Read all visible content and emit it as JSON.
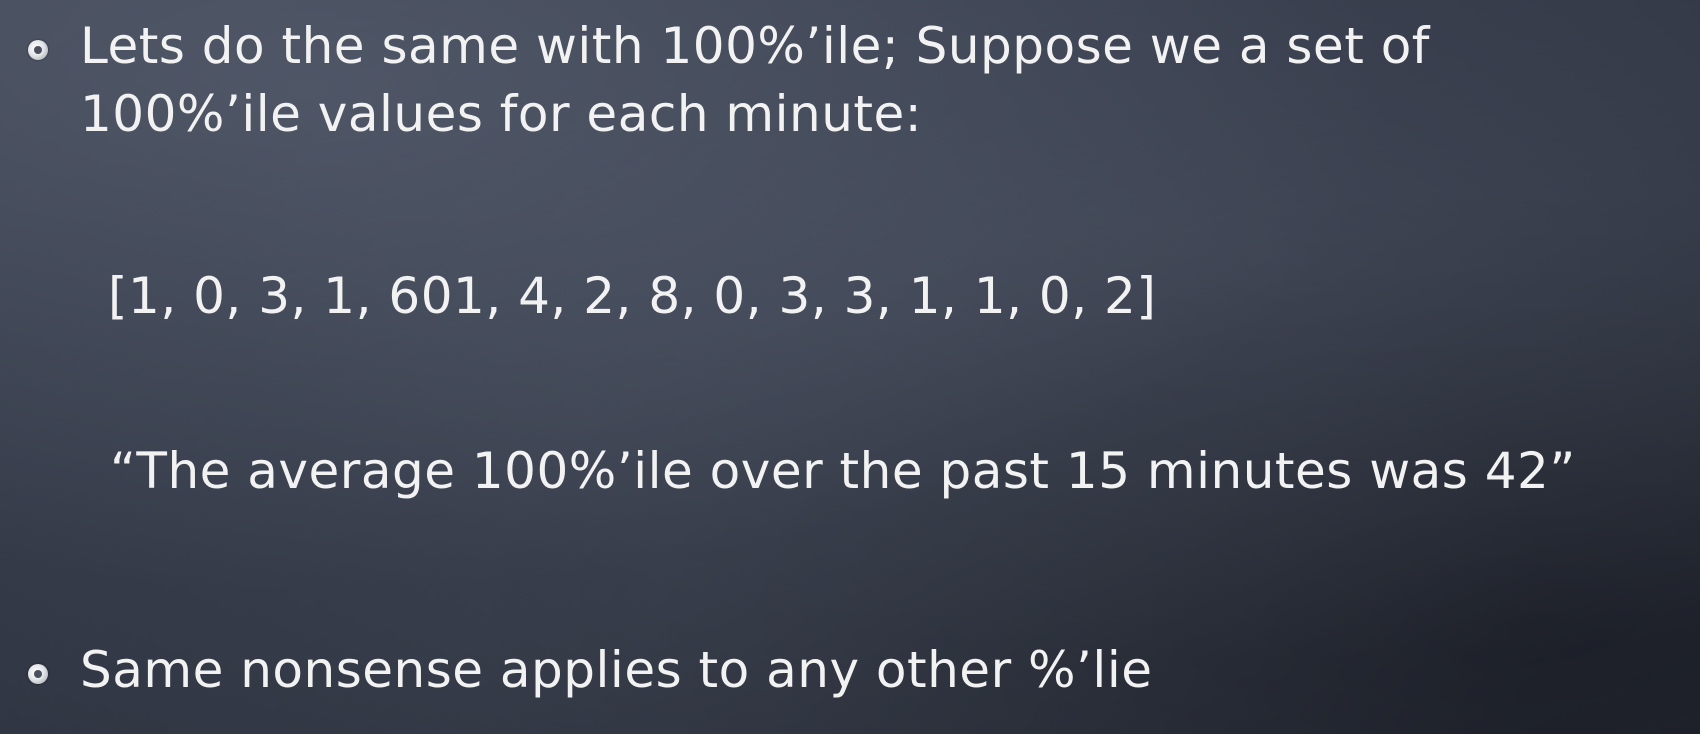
{
  "slide": {
    "bullets": [
      {
        "line1": "Lets do the same with 100%’ile; Suppose we a set of",
        "line2": "100%’ile values for each minute:"
      },
      {
        "line1": "Same nonsense applies to any other %’lie"
      }
    ],
    "data_array": "[1, 0, 3, 1, 601, 4, 2, 8, 0, 3, 3, 1, 1, 0, 2]",
    "quote": "“The average 100%’ile over the past 15 minutes was 42”"
  }
}
